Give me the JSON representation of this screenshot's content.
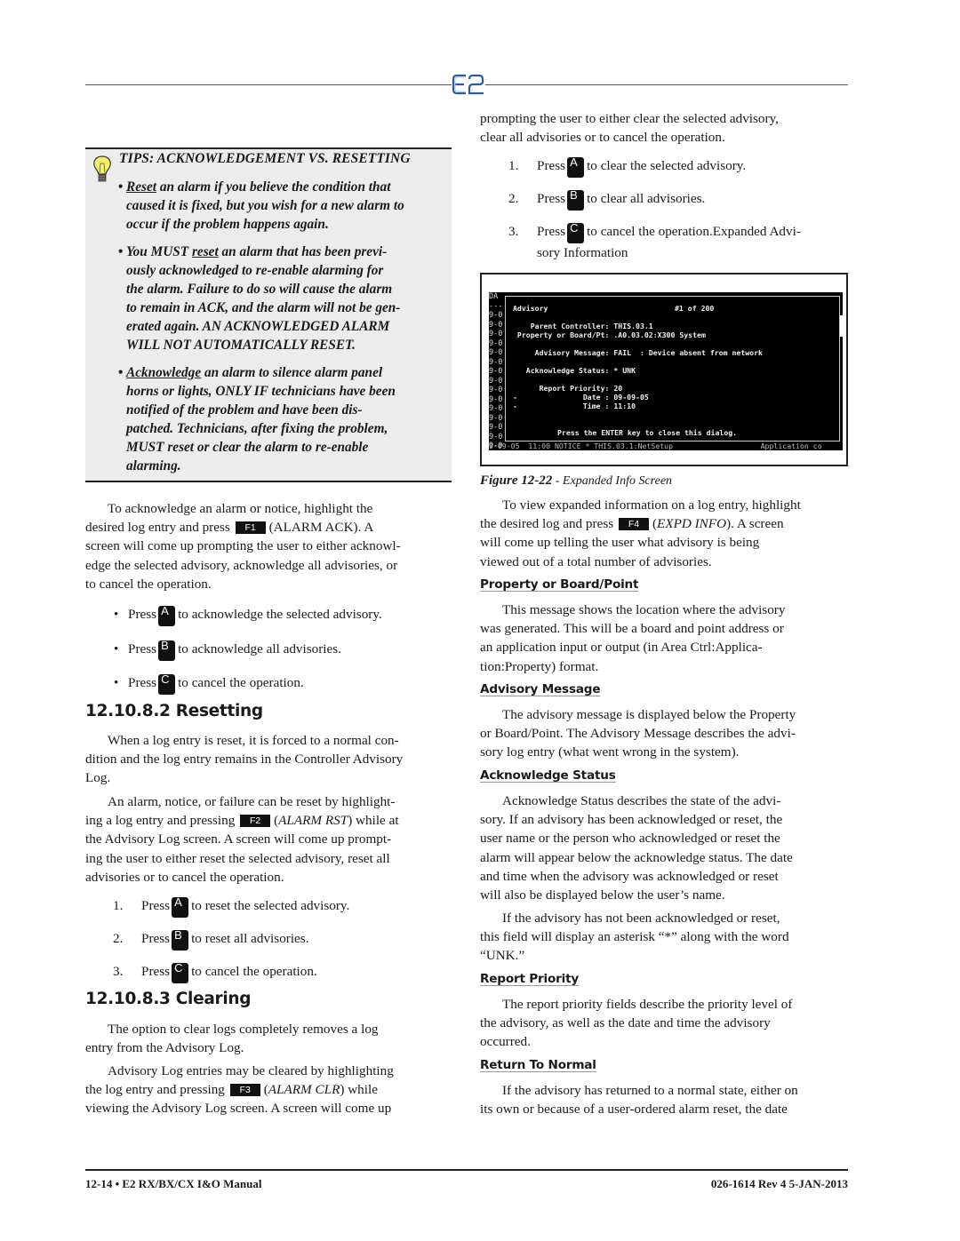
{
  "header": {
    "logo_text": "E2",
    "logo_color": "#2a5d9a"
  },
  "tips": {
    "title": "TIPS: ACKNOWLEDGEMENT VS. RESETTING",
    "icon": "lightbulb-icon",
    "items": [
      {
        "keyword": "Reset",
        "lines": [
          " an alarm if you believe the condition that",
          "caused it is fixed, but you wish for a new alarm to",
          "occur if the problem happens again."
        ]
      },
      {
        "prefix": "You MUST ",
        "keyword": "reset",
        "lines": [
          " an alarm that has been previ-",
          "ously acknowledged to re-enable alarming for",
          "the alarm. Failure to do so will cause the alarm",
          "to remain in ACK, and the alarm will not be gen-",
          "erated again. AN ACKNOWLEDGED ALARM",
          "WILL NOT AUTOMATICALLY RESET."
        ]
      },
      {
        "keyword": "Acknowledge",
        "lines": [
          " an alarm to silence alarm panel",
          "horns or lights, ONLY IF technicians have been",
          "notified of the problem and have been dis-",
          "patched. Technicians, after fixing the problem,",
          "MUST reset or clear the alarm to re-enable",
          "alarming."
        ]
      }
    ]
  },
  "left": {
    "ack_para": {
      "line1": "To acknowledge an alarm or notice, highlight the",
      "line2_pre": "desired log entry and press",
      "key": "F1",
      "line2_post": "(ALARM ACK). A",
      "rest": [
        "screen will come up prompting the user to either acknowl-",
        "edge the selected advisory, acknowledge all advisories, or",
        "to cancel the operation."
      ]
    },
    "ack_list": [
      {
        "marker": "•",
        "pre": "Press",
        "key": "A",
        "text": "to acknowledge the selected advisory."
      },
      {
        "marker": "•",
        "pre": "Press",
        "key": "B",
        "text": "to acknowledge all advisories."
      },
      {
        "marker": "•",
        "pre": "Press",
        "key": "C",
        "text": "to cancel the operation."
      }
    ],
    "resetting": {
      "heading": "12.10.8.2  Resetting",
      "para1": [
        "When a log entry is reset, it is forced to a normal con-",
        "dition and the log entry remains in the Controller Advisory",
        "Log."
      ],
      "para2_line1": "An alarm, notice, or failure can be reset by highlight-",
      "para2_line2_pre": "ing a log entry and pressing",
      "para2_key": "F2",
      "para2_line2_italic": "ALARM RST",
      "para2_line2_post": ") while at",
      "para2_rest": [
        "the Advisory Log screen. A screen will come up prompt-",
        "ing the user to either reset the selected advisory, reset all",
        "advisories or to cancel the operation."
      ],
      "list": [
        {
          "marker": "1.",
          "pre": "Press",
          "key": "A",
          "text": "to reset the selected advisory."
        },
        {
          "marker": "2.",
          "pre": "Press",
          "key": "B",
          "text": "to reset all advisories."
        },
        {
          "marker": "3.",
          "pre": "Press",
          "key": "C",
          "text": "to cancel the operation."
        }
      ]
    },
    "clearing": {
      "heading": "12.10.8.3 Clearing",
      "para1": [
        "The option to clear logs completely removes a log",
        "entry from the Advisory Log."
      ],
      "para2_line1": "Advisory Log entries may be cleared by highlighting",
      "para2_line2_pre": "the log entry and pressing",
      "para2_key": "F3",
      "para2_line2_italic": "ALARM CLR",
      "para2_line2_post": ") while",
      "para2_line3": "viewing the Advisory Log screen. A screen will come up"
    }
  },
  "right": {
    "cont_para": [
      "prompting the user to either clear the selected advisory,",
      "clear all advisories or to cancel the operation."
    ],
    "clear_list": [
      {
        "marker": "1.",
        "pre": "Press",
        "key": "A",
        "text": "to clear the selected advisory."
      },
      {
        "marker": "2.",
        "pre": "Press",
        "key": "B",
        "text": "to clear all advisories."
      },
      {
        "marker": "3.",
        "pre": "Press",
        "key": "C",
        "text": "to cancel the operation.Expanded Advi-",
        "text2": "sory Information"
      }
    ],
    "figure": {
      "screen": {
        "bg_header": "DA",
        "bg_rows": [
          "---",
          "9-0",
          "9-0",
          "9-0",
          "9-0",
          "9-0",
          "9-0",
          "9-0",
          "9-0",
          "9-0",
          "9-0",
          "9-0",
          "9-0",
          "9-0",
          "9-0",
          "9-0"
        ],
        "bg_bottom": "9-09-05  11:00 NOTICE * THIS.03.1:NetSetup                    Application co",
        "title": "Advisory",
        "counter": "#1 of 200",
        "fields": [
          {
            "label": "    Parent Controller:",
            "value": "THIS.03.1"
          },
          {
            "label": " Property or Board/Pt:",
            "value": ".A0.03.02:X300 System"
          },
          {
            "label": "     Advisory Message:",
            "value": "FAIL  : Device absent from network"
          },
          {
            "label": "   Acknowledge Status:",
            "value": "* UNK"
          },
          {
            "label": "      Report Priority:",
            "value": "20"
          },
          {
            "label": "-               Date :",
            "value": "09-09-05"
          },
          {
            "label": "-               Time :",
            "value": "11:10"
          }
        ],
        "footer": "Press the ENTER key to close this dialog."
      },
      "caption_label": "Figure 12-22",
      "caption_text": " - Expanded Info Screen"
    },
    "expd_para": {
      "line1": "To view expanded information on a log entry, highlight",
      "line2_pre": "the desired log and press",
      "key": "F4",
      "line2_italic": "EXPD INFO",
      "line2_post": "). A screen",
      "rest": [
        "will come up telling the user what advisory is being",
        "viewed out of a total number of advisories."
      ]
    },
    "sections": [
      {
        "heading": "Property or Board/Point",
        "lines": [
          "This message shows the location where the advisory",
          "was generated. This will be a board and point address or",
          "an application input or output (in Area Ctrl:Applica-",
          "tion:Property) format."
        ]
      },
      {
        "heading": "Advisory Message",
        "lines": [
          "The advisory message is displayed below the Property",
          "or Board/Point. The Advisory Message describes the advi-",
          "sory log entry (what went wrong in the system)."
        ]
      },
      {
        "heading": "Acknowledge Status",
        "lines": [
          "Acknowledge Status describes the state of the advi-",
          "sory. If an advisory has been acknowledged or reset, the",
          "user name or the person who acknowledged or reset the",
          "alarm will appear below the acknowledge status. The date",
          "and time when the advisory was acknowledged or reset",
          "will also be displayed below the user’s name."
        ],
        "lines2": [
          "If the advisory has not been acknowledged or reset,",
          "this field will display an asterisk “*” along with the word",
          "“UNK.”"
        ]
      },
      {
        "heading": "Report Priority",
        "lines": [
          "The report priority fields describe the priority level of",
          "the advisory, as well as the date and time the advisory",
          "occurred."
        ]
      },
      {
        "heading": "Return To Normal",
        "lines": [
          "If the advisory has returned to a normal state, either on",
          "its own or because of a user-ordered alarm reset, the date"
        ]
      }
    ]
  },
  "footer": {
    "left": "12-14 • E2 RX/BX/CX I&O Manual",
    "right": "026-1614 Rev 4 5-JAN-2013"
  }
}
